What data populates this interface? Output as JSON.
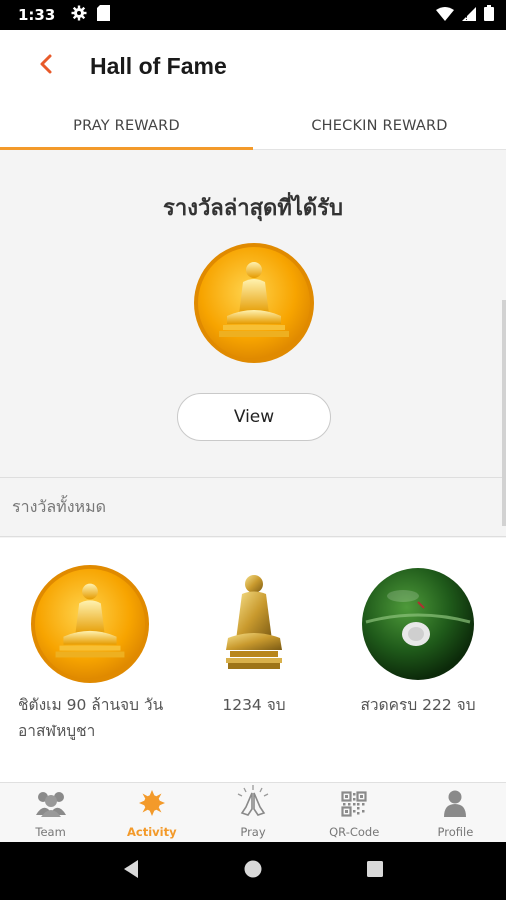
{
  "status_bar": {
    "time": "1:33",
    "icons": [
      "gear-icon",
      "sim-card-icon",
      "wifi-icon",
      "signal-icon",
      "battery-icon"
    ]
  },
  "app_bar": {
    "title": "Hall of Fame",
    "back_icon": "chevron-left-icon"
  },
  "tabs": [
    {
      "label": "PRAY REWARD",
      "active": true
    },
    {
      "label": "CHECKIN REWARD",
      "active": false
    }
  ],
  "latest_reward": {
    "title": "รางวัลล่าสุดที่ได้รับ",
    "image": "gold-meditation-medal",
    "view_label": "View"
  },
  "all_rewards": {
    "header": "รางวัลทั้งหมด",
    "items": [
      {
        "image": "gold-meditation-medal",
        "label": "ชิตังเม 90 ล้านจบ วันอาสฬหบูชา"
      },
      {
        "image": "gold-monk-statue",
        "label": "1234 จบ"
      },
      {
        "image": "green-amulet",
        "label": "สวดครบ 222 จบ"
      }
    ]
  },
  "bottom_nav": [
    {
      "label": "Team",
      "icon": "team-icon",
      "active": false
    },
    {
      "label": "Activity",
      "icon": "activity-icon",
      "active": true
    },
    {
      "label": "Pray",
      "icon": "pray-icon",
      "active": false
    },
    {
      "label": "QR-Code",
      "icon": "qr-code-icon",
      "active": false
    },
    {
      "label": "Profile",
      "icon": "profile-icon",
      "active": false
    }
  ],
  "colors": {
    "accent": "#f39a2a",
    "back_arrow": "#e85a2a",
    "gold": "#f5a800"
  }
}
